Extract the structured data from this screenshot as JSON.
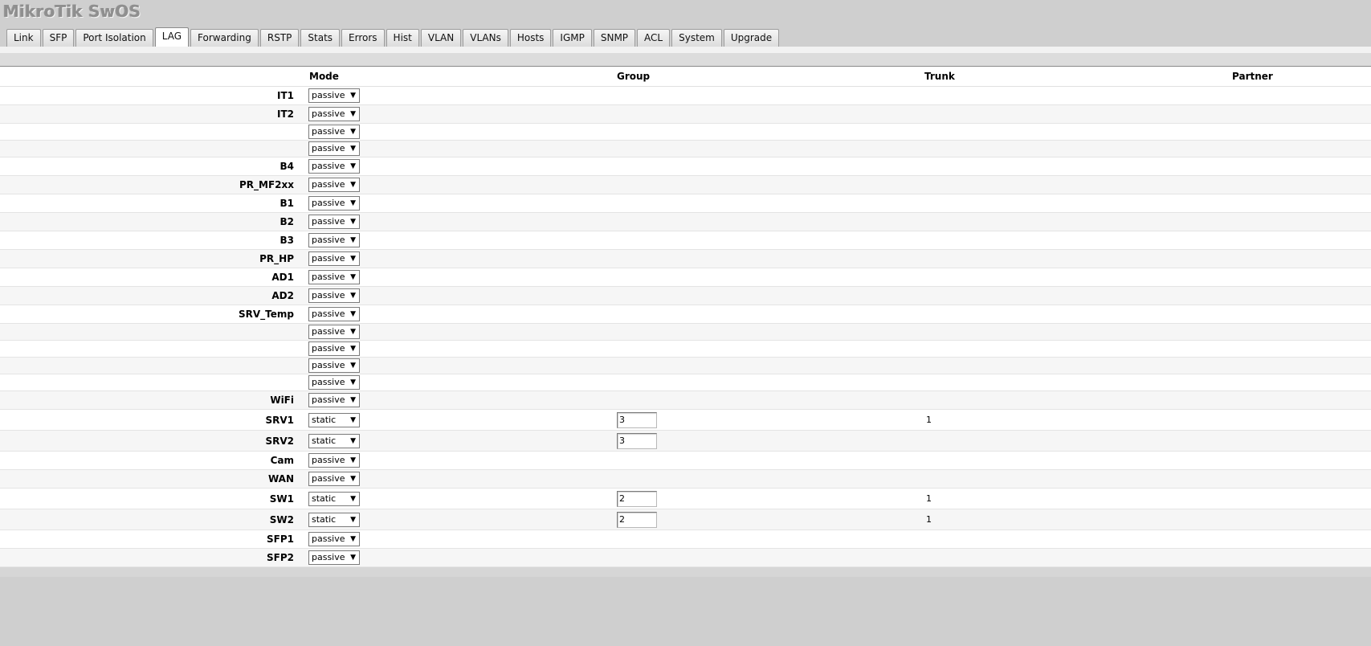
{
  "app": {
    "title": "MikroTik SwOS"
  },
  "tabs": [
    {
      "label": "Link"
    },
    {
      "label": "SFP"
    },
    {
      "label": "Port Isolation"
    },
    {
      "label": "LAG"
    },
    {
      "label": "Forwarding"
    },
    {
      "label": "RSTP"
    },
    {
      "label": "Stats"
    },
    {
      "label": "Errors"
    },
    {
      "label": "Hist"
    },
    {
      "label": "VLAN"
    },
    {
      "label": "VLANs"
    },
    {
      "label": "Hosts"
    },
    {
      "label": "IGMP"
    },
    {
      "label": "SNMP"
    },
    {
      "label": "ACL"
    },
    {
      "label": "System"
    },
    {
      "label": "Upgrade"
    }
  ],
  "active_tab": "LAG",
  "table": {
    "headers": {
      "mode": "Mode",
      "group": "Group",
      "trunk": "Trunk",
      "partner": "Partner"
    },
    "rows": [
      {
        "name": "IT1",
        "mode": "passive",
        "group": "",
        "trunk": "",
        "partner": ""
      },
      {
        "name": "IT2",
        "mode": "passive",
        "group": "",
        "trunk": "",
        "partner": ""
      },
      {
        "name": "",
        "mode": "passive",
        "group": "",
        "trunk": "",
        "partner": ""
      },
      {
        "name": "",
        "mode": "passive",
        "group": "",
        "trunk": "",
        "partner": ""
      },
      {
        "name": "B4",
        "mode": "passive",
        "group": "",
        "trunk": "",
        "partner": ""
      },
      {
        "name": "PR_MF2xx",
        "mode": "passive",
        "group": "",
        "trunk": "",
        "partner": ""
      },
      {
        "name": "B1",
        "mode": "passive",
        "group": "",
        "trunk": "",
        "partner": ""
      },
      {
        "name": "B2",
        "mode": "passive",
        "group": "",
        "trunk": "",
        "partner": ""
      },
      {
        "name": "B3",
        "mode": "passive",
        "group": "",
        "trunk": "",
        "partner": ""
      },
      {
        "name": "PR_HP",
        "mode": "passive",
        "group": "",
        "trunk": "",
        "partner": ""
      },
      {
        "name": "AD1",
        "mode": "passive",
        "group": "",
        "trunk": "",
        "partner": ""
      },
      {
        "name": "AD2",
        "mode": "passive",
        "group": "",
        "trunk": "",
        "partner": ""
      },
      {
        "name": "SRV_Temp",
        "mode": "passive",
        "group": "",
        "trunk": "",
        "partner": ""
      },
      {
        "name": "",
        "mode": "passive",
        "group": "",
        "trunk": "",
        "partner": ""
      },
      {
        "name": "",
        "mode": "passive",
        "group": "",
        "trunk": "",
        "partner": ""
      },
      {
        "name": "",
        "mode": "passive",
        "group": "",
        "trunk": "",
        "partner": ""
      },
      {
        "name": "",
        "mode": "passive",
        "group": "",
        "trunk": "",
        "partner": ""
      },
      {
        "name": "WiFi",
        "mode": "passive",
        "group": "",
        "trunk": "",
        "partner": ""
      },
      {
        "name": "SRV1",
        "mode": "static",
        "group": "3",
        "trunk": "1",
        "partner": ""
      },
      {
        "name": "SRV2",
        "mode": "static",
        "group": "3",
        "trunk": "",
        "partner": ""
      },
      {
        "name": "Cam",
        "mode": "passive",
        "group": "",
        "trunk": "",
        "partner": ""
      },
      {
        "name": "WAN",
        "mode": "passive",
        "group": "",
        "trunk": "",
        "partner": ""
      },
      {
        "name": "SW1",
        "mode": "static",
        "group": "2",
        "trunk": "1",
        "partner": ""
      },
      {
        "name": "SW2",
        "mode": "static",
        "group": "2",
        "trunk": "1",
        "partner": ""
      },
      {
        "name": "SFP1",
        "mode": "passive",
        "group": "",
        "trunk": "",
        "partner": ""
      },
      {
        "name": "SFP2",
        "mode": "passive",
        "group": "",
        "trunk": "",
        "partner": ""
      }
    ]
  }
}
